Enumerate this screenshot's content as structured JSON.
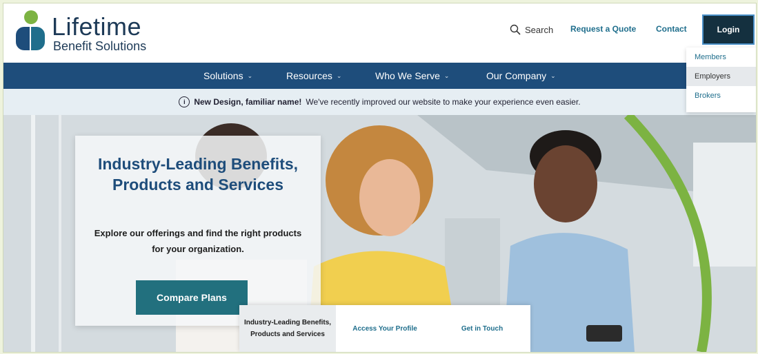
{
  "logo": {
    "name": "Lifetime",
    "sub": "Benefit Solutions"
  },
  "header": {
    "search_label": "Search",
    "search_icon": "search-icon",
    "quote_label": "Request a Quote",
    "contact_label": "Contact",
    "login_label": "Login"
  },
  "login_menu": {
    "items": [
      {
        "label": "Members"
      },
      {
        "label": "Employers"
      },
      {
        "label": "Brokers"
      }
    ]
  },
  "nav": {
    "items": [
      {
        "label": "Solutions"
      },
      {
        "label": "Resources"
      },
      {
        "label": "Who We Serve"
      },
      {
        "label": "Our Company"
      }
    ]
  },
  "notice": {
    "bold": "New Design, familiar name!",
    "text": "We've recently improved our website to make your experience even easier."
  },
  "hero": {
    "title": "Industry-Leading Benefits, Products and Services",
    "subtitle": "Explore our offerings and find the right products for your organization.",
    "cta_label": "Compare Plans"
  },
  "tabs": {
    "items": [
      {
        "label": "Industry-Leading Benefits, Products and Services"
      },
      {
        "label": "Access Your Profile"
      },
      {
        "label": "Get in Touch"
      }
    ]
  },
  "colors": {
    "navy": "#1e4d7b",
    "teal": "#22707e",
    "green": "#7cb342",
    "link": "#1f6e8c",
    "login_bg": "#14303f"
  }
}
